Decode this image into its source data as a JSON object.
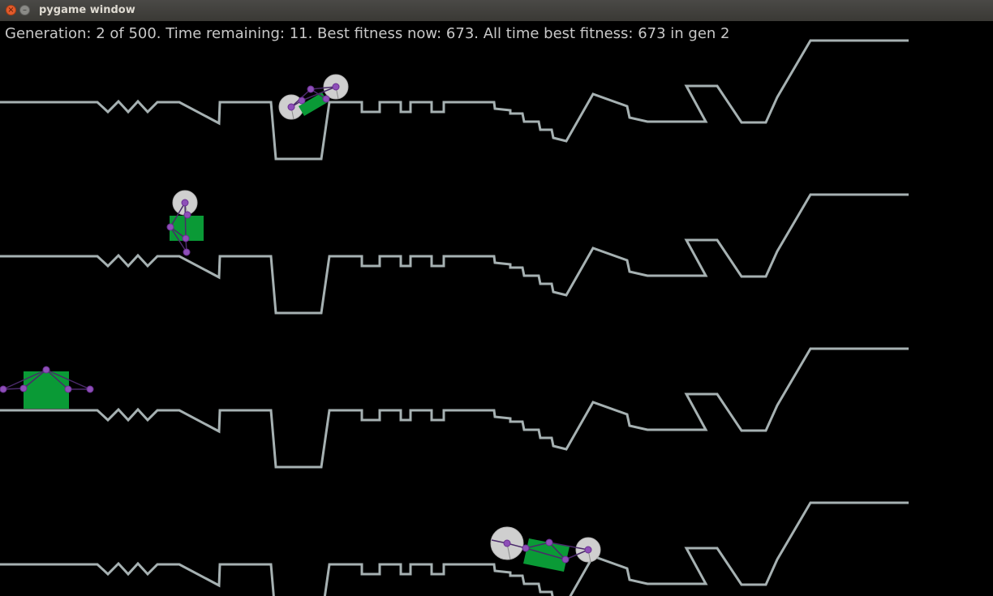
{
  "window": {
    "title": "pygame window",
    "close_glyph": "×",
    "minimize_glyph": "–"
  },
  "status": "Generation: 2 of 500.   Time remaining: 11.   Best fitness now: 673.   All time best fitness: 673 in gen 2",
  "colors": {
    "background": "#000000",
    "track": "#a6b1b2",
    "chassis": "#0a9a36",
    "joint": "#8e4fb8",
    "spring": "#4a2a6a",
    "wheel": "#cfcfcf"
  },
  "lanes": [
    {
      "name": "lane-1"
    },
    {
      "name": "lane-2"
    },
    {
      "name": "lane-3"
    },
    {
      "name": "lane-4"
    }
  ],
  "cars": [
    {
      "name": "car-lane-1",
      "lane": 1
    },
    {
      "name": "car-lane-2",
      "lane": 2
    },
    {
      "name": "car-lane-3",
      "lane": 3
    },
    {
      "name": "car-lane-4",
      "lane": 4
    }
  ]
}
